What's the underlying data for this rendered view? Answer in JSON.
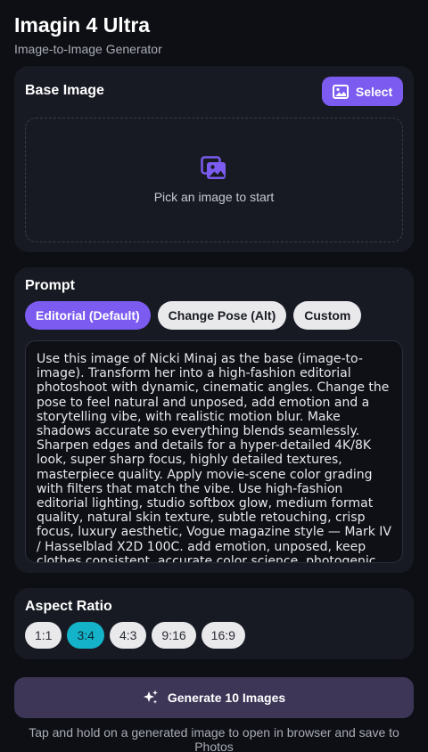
{
  "app": {
    "title": "Imagin 4 Ultra",
    "subtitle": "Image-to-Image Generator"
  },
  "base_image": {
    "title": "Base Image",
    "select_label": "Select",
    "select_icon": "image-icon",
    "placeholder_icon": "images-icon",
    "placeholder_text": "Pick an image to start"
  },
  "prompt": {
    "title": "Prompt",
    "presets": [
      {
        "label": "Editorial (Default)",
        "active": true
      },
      {
        "label": "Change Pose (Alt)",
        "active": false
      },
      {
        "label": "Custom",
        "active": false
      }
    ],
    "text": "Use this image of Nicki Minaj as the base (image-to-image). Transform her into a high-fashion editorial photoshoot with dynamic, cinematic angles. Change the pose to feel natural and unposed, add emotion and a storytelling vibe, with realistic motion blur. Make shadows accurate so everything blends seamlessly. Sharpen edges and details for a hyper-detailed 4K/8K look, super sharp focus, highly detailed textures, masterpiece quality. Apply movie-scene color grading with filters that match the vibe. Use high-fashion editorial lighting, studio softbox glow, medium format quality, natural skin texture, subtle retouching, crisp focus, luxury aesthetic, Vogue magazine style — Mark IV / Hasselblad X2D 100C. add emotion, unposed, keep clothes consistent, accurate color science, photogenic, unpredictable."
  },
  "aspect_ratio": {
    "title": "Aspect Ratio",
    "options": [
      "1:1",
      "3:4",
      "4:3",
      "9:16",
      "16:9"
    ],
    "selected": "3:4"
  },
  "generate": {
    "label": "Generate 10 Images",
    "icon": "sparkles-icon"
  },
  "footer": {
    "note": "Tap and hold on a generated image to open in browser and save to Photos"
  },
  "colors": {
    "accent": "#7c5cf0",
    "selected_ratio": "#15b3c9",
    "generate_bg": "#3d3657",
    "card_bg": "#171a23",
    "page_bg": "#0d0f14"
  }
}
